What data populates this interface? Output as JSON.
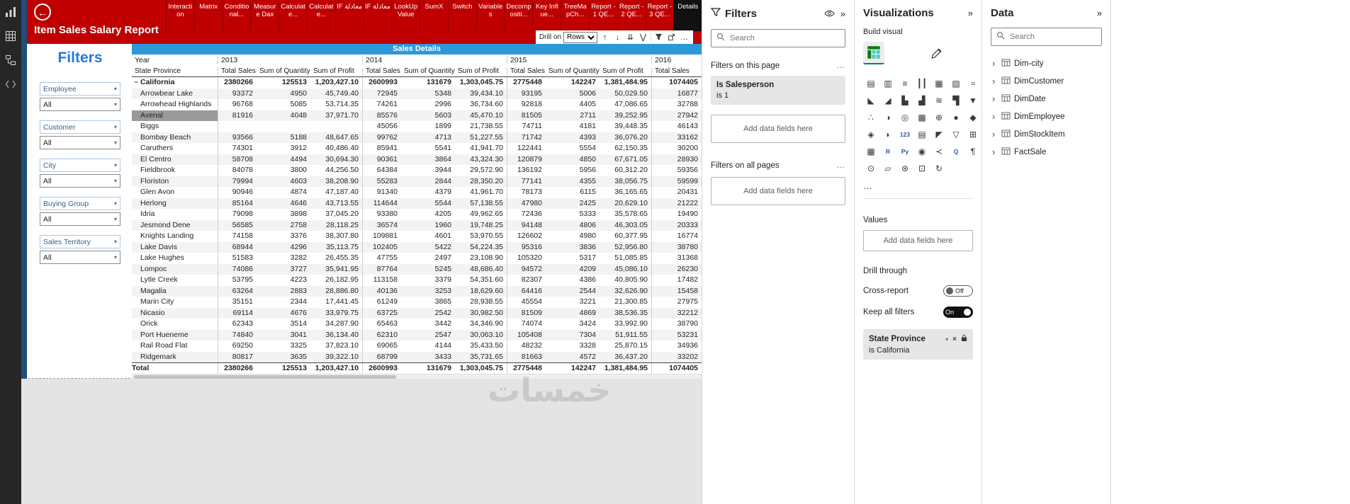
{
  "nav_rail": {
    "items": [
      {
        "name": "report-view-icon"
      },
      {
        "name": "data-view-icon"
      },
      {
        "name": "model-view-icon"
      },
      {
        "name": "dax-query-view-icon"
      }
    ]
  },
  "header": {
    "title": "Item Sales Salary Report",
    "tabs": [
      {
        "label": "Interaction"
      },
      {
        "label": "Matrix"
      },
      {
        "label": "Conditional..."
      },
      {
        "label": "Measure Dax"
      },
      {
        "label": "Calculate..."
      },
      {
        "label": "Calculate..."
      },
      {
        "label": "IF معادلة"
      },
      {
        "label": "IF معادلة"
      },
      {
        "label": "LookUpValue"
      },
      {
        "label": "SumX"
      },
      {
        "label": "Switch"
      },
      {
        "label": "Variables"
      },
      {
        "label": "Decompositi..."
      },
      {
        "label": "Key Influe..."
      },
      {
        "label": "TreeMapCh..."
      },
      {
        "label": "Report -1 QE..."
      },
      {
        "label": "Report -2 QE..."
      },
      {
        "label": "Report -3 QE..."
      },
      {
        "label": "Details",
        "active": true
      }
    ]
  },
  "drill_toolbar": {
    "label": "Drill on",
    "mode": "Rows",
    "more": "…"
  },
  "filter_sidebar": {
    "title": "Filters",
    "slicers": [
      {
        "label": "Employee",
        "value": "All"
      },
      {
        "label": "Customer",
        "value": "All"
      },
      {
        "label": "City",
        "value": "All"
      },
      {
        "label": "Buying Group",
        "value": "All"
      },
      {
        "label": "Sales Territory",
        "value": "All"
      }
    ]
  },
  "matrix": {
    "title": "Sales Details",
    "corner_row1": "Year",
    "corner_row2": "State Province",
    "years": [
      "2013",
      "2014",
      "2015",
      "2016"
    ],
    "measures": [
      "Total Sales",
      "Sum of Quantity",
      "Sum of Profit"
    ],
    "rows": [
      {
        "name": "California",
        "expand": "−",
        "bold": true,
        "values": [
          "2380266",
          "125513",
          "1,203,427.10",
          "2600993",
          "131679",
          "1,303,045.75",
          "2775448",
          "142247",
          "1,381,484.95",
          "1074405"
        ]
      },
      {
        "name": "Arrowbear Lake",
        "values": [
          "93372",
          "4950",
          "45,749.40",
          "72945",
          "5348",
          "39,434.10",
          "93195",
          "5006",
          "50,029.50",
          "16877"
        ]
      },
      {
        "name": "Arrowhead Highlands",
        "values": [
          "96768",
          "5085",
          "53,714.35",
          "74261",
          "2996",
          "36,734.60",
          "92818",
          "4405",
          "47,086.65",
          "32788"
        ]
      },
      {
        "name": "Avenal",
        "selected": true,
        "values": [
          "81916",
          "4048",
          "37,971.70",
          "85576",
          "5603",
          "45,470.10",
          "81505",
          "2711",
          "39,252.95",
          "27942"
        ]
      },
      {
        "name": "Biggs",
        "values": [
          "",
          "",
          "",
          "45056",
          "1899",
          "21,738.55",
          "74711",
          "4181",
          "39,448.35",
          "46143"
        ]
      },
      {
        "name": "Bombay Beach",
        "values": [
          "93566",
          "5188",
          "48,647.65",
          "99762",
          "4713",
          "51,227.55",
          "71742",
          "4393",
          "36,076.20",
          "33162"
        ]
      },
      {
        "name": "Caruthers",
        "values": [
          "74301",
          "3912",
          "40,486.40",
          "85941",
          "5541",
          "41,941.70",
          "122441",
          "5554",
          "62,150.35",
          "30200"
        ]
      },
      {
        "name": "El Centro",
        "values": [
          "58708",
          "4494",
          "30,694.30",
          "90361",
          "3864",
          "43,324.30",
          "120879",
          "4850",
          "67,671.05",
          "28930"
        ]
      },
      {
        "name": "Fieldbrook",
        "values": [
          "84078",
          "3800",
          "44,256.50",
          "64384",
          "3944",
          "29,572.90",
          "136192",
          "5956",
          "60,312.20",
          "59356"
        ]
      },
      {
        "name": "Floriston",
        "values": [
          "79994",
          "4603",
          "38,208.90",
          "55283",
          "2844",
          "28,350.20",
          "77141",
          "4355",
          "38,056.75",
          "59599"
        ]
      },
      {
        "name": "Glen Avon",
        "values": [
          "90946",
          "4874",
          "47,187.40",
          "91340",
          "4379",
          "41,961.70",
          "78173",
          "6115",
          "36,165.65",
          "20431"
        ]
      },
      {
        "name": "Herlong",
        "values": [
          "85164",
          "4646",
          "43,713.55",
          "114644",
          "5544",
          "57,138.55",
          "47980",
          "2425",
          "20,629.10",
          "21222"
        ]
      },
      {
        "name": "Idria",
        "values": [
          "79098",
          "3898",
          "37,045.20",
          "93380",
          "4205",
          "49,962.65",
          "72436",
          "5333",
          "35,578.65",
          "19490"
        ]
      },
      {
        "name": "Jesmond Dene",
        "values": [
          "56585",
          "2758",
          "28,118.25",
          "36574",
          "1960",
          "19,748.25",
          "94148",
          "4806",
          "46,303.05",
          "20333"
        ]
      },
      {
        "name": "Knights Landing",
        "values": [
          "74158",
          "3376",
          "38,307.80",
          "109881",
          "4601",
          "53,970.55",
          "126602",
          "4980",
          "60,377.95",
          "16774"
        ]
      },
      {
        "name": "Lake Davis",
        "values": [
          "68944",
          "4296",
          "35,113.75",
          "102405",
          "5422",
          "54,224.35",
          "95316",
          "3836",
          "52,956.80",
          "38780"
        ]
      },
      {
        "name": "Lake Hughes",
        "values": [
          "51583",
          "3282",
          "26,455.35",
          "47755",
          "2497",
          "23,108.90",
          "105320",
          "5317",
          "51,085.85",
          "31368"
        ]
      },
      {
        "name": "Lompoc",
        "values": [
          "74086",
          "3727",
          "35,941.95",
          "87764",
          "5245",
          "48,686.40",
          "94572",
          "4209",
          "45,086.10",
          "26230"
        ]
      },
      {
        "name": "Lytle Creek",
        "values": [
          "53795",
          "4223",
          "26,182.95",
          "113158",
          "3379",
          "54,351.60",
          "82307",
          "4386",
          "40,805.90",
          "17482"
        ]
      },
      {
        "name": "Magalia",
        "values": [
          "63264",
          "2883",
          "28,886.80",
          "40136",
          "3253",
          "18,629.60",
          "64416",
          "2544",
          "32,626.90",
          "15458"
        ]
      },
      {
        "name": "Marin City",
        "values": [
          "35151",
          "2344",
          "17,441.45",
          "61249",
          "3865",
          "28,938.55",
          "45554",
          "3221",
          "21,300.85",
          "27975"
        ]
      },
      {
        "name": "Nicasio",
        "values": [
          "69114",
          "4676",
          "33,979.75",
          "63725",
          "2542",
          "30,982.50",
          "81509",
          "4869",
          "38,536.35",
          "32212"
        ]
      },
      {
        "name": "Orick",
        "values": [
          "62343",
          "3514",
          "34,287.90",
          "65463",
          "3442",
          "34,346.90",
          "74074",
          "3424",
          "33,992.90",
          "38790"
        ]
      },
      {
        "name": "Port Hueneme",
        "values": [
          "74840",
          "3041",
          "36,134.40",
          "62310",
          "2547",
          "30,063.10",
          "105408",
          "7304",
          "51,911.55",
          "53231"
        ]
      },
      {
        "name": "Rail Road Flat",
        "values": [
          "69250",
          "3325",
          "37,823.10",
          "69065",
          "4144",
          "35,433.50",
          "48232",
          "3328",
          "25,870.15",
          "34936"
        ]
      },
      {
        "name": "Ridgemark",
        "values": [
          "80817",
          "3635",
          "39,322.10",
          "68799",
          "3433",
          "35,731.65",
          "81663",
          "4572",
          "36,437.20",
          "33202"
        ]
      },
      {
        "name": "Total",
        "total": true,
        "bold": true,
        "values": [
          "2380266",
          "125513",
          "1,203,427.10",
          "2600993",
          "131679",
          "1,303,045.75",
          "2775448",
          "142247",
          "1,381,484.95",
          "1074405"
        ]
      }
    ]
  },
  "filters_pane": {
    "title": "Filters",
    "search_placeholder": "Search",
    "section_this_page": "Filters on this page",
    "section_all_pages": "Filters on all pages",
    "more": "…",
    "card": {
      "title": "Is Salesperson",
      "condition": "is 1"
    },
    "add_fields": "Add data fields here"
  },
  "viz_pane": {
    "title": "Visualizations",
    "build_label": "Build visual",
    "more": "…",
    "values_label": "Values",
    "add_fields": "Add data fields here",
    "drill_through_label": "Drill through",
    "cross_report": {
      "label": "Cross-report",
      "state": "Off"
    },
    "keep_filters": {
      "label": "Keep all filters",
      "state": "On"
    },
    "drill_filter_card": {
      "title": "State Province",
      "condition": "is California"
    },
    "icons": [
      {
        "name": "stacked-bar-chart-icon",
        "glyph": "▤"
      },
      {
        "name": "stacked-column-chart-icon",
        "glyph": "▥"
      },
      {
        "name": "clustered-bar-chart-icon",
        "glyph": "≡"
      },
      {
        "name": "clustered-column-chart-icon",
        "glyph": "┃┃"
      },
      {
        "name": "100-stacked-bar-chart-icon",
        "glyph": "▦"
      },
      {
        "name": "100-stacked-column-chart-icon",
        "glyph": "▧"
      },
      {
        "name": "line-chart-icon",
        "glyph": "≈"
      },
      {
        "name": "area-chart-icon",
        "glyph": "◣"
      },
      {
        "name": "stacked-area-chart-icon",
        "glyph": "◢"
      },
      {
        "name": "line-and-stacked-column-chart-icon",
        "glyph": "▙"
      },
      {
        "name": "line-and-clustered-column-chart-icon",
        "glyph": "▟"
      },
      {
        "name": "ribbon-chart-icon",
        "glyph": "≋"
      },
      {
        "name": "waterfall-chart-icon",
        "glyph": "▜"
      },
      {
        "name": "funnel-chart-icon",
        "glyph": "▼"
      },
      {
        "name": "scatter-chart-icon",
        "glyph": "∴"
      },
      {
        "name": "pie-chart-icon",
        "glyph": "◑"
      },
      {
        "name": "donut-chart-icon",
        "glyph": "◎"
      },
      {
        "name": "treemap-icon",
        "glyph": "▩"
      },
      {
        "name": "map-icon",
        "glyph": "⊕"
      },
      {
        "name": "filled-map-icon",
        "glyph": "●"
      },
      {
        "name": "shape-map-icon",
        "glyph": "◆"
      },
      {
        "name": "azure-map-icon",
        "glyph": "◈"
      },
      {
        "name": "gauge-icon",
        "glyph": "◗"
      },
      {
        "name": "card-icon",
        "glyph": "123",
        "text": true
      },
      {
        "name": "multi-row-card-icon",
        "glyph": "▤"
      },
      {
        "name": "kpi-icon",
        "glyph": "◤"
      },
      {
        "name": "slicer-icon",
        "glyph": "▽"
      },
      {
        "name": "table-icon",
        "glyph": "⊞"
      },
      {
        "name": "matrix-icon",
        "glyph": "▦"
      },
      {
        "name": "r-script-visual-icon",
        "glyph": "R",
        "text": true
      },
      {
        "name": "python-visual-icon",
        "glyph": "Py",
        "text": true
      },
      {
        "name": "key-influencers-icon",
        "glyph": "◉"
      },
      {
        "name": "decomposition-tree-icon",
        "glyph": "≺"
      },
      {
        "name": "qa-visual-icon",
        "glyph": "Q",
        "text": true
      },
      {
        "name": "smart-narrative-icon",
        "glyph": "¶"
      },
      {
        "name": "metrics-icon",
        "glyph": "⊙"
      },
      {
        "name": "paginated-report-icon",
        "glyph": "▱"
      },
      {
        "name": "arcgis-map-icon",
        "glyph": "⊛"
      },
      {
        "name": "power-apps-icon",
        "glyph": "⊡"
      },
      {
        "name": "power-automate-icon",
        "glyph": "↻"
      }
    ]
  },
  "data_pane": {
    "title": "Data",
    "search_placeholder": "Search",
    "tables": [
      {
        "label": "Dim-city"
      },
      {
        "label": "DimCustomer"
      },
      {
        "label": "DimDate"
      },
      {
        "label": "DimEmployee"
      },
      {
        "label": "DimStockItem"
      },
      {
        "label": "FactSale"
      }
    ]
  },
  "watermark": "خمسات"
}
